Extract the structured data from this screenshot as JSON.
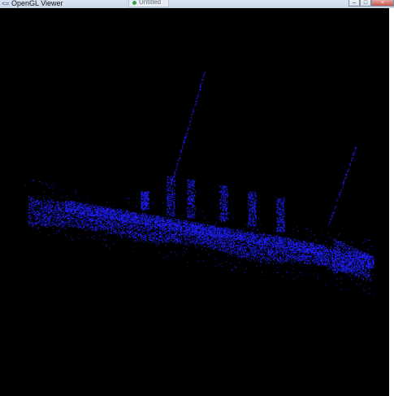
{
  "window": {
    "title": "OpenGL Viewer",
    "background_tab_label": "Untitled",
    "controls": {
      "minimize_icon": "minimize-icon",
      "maximize_icon": "maximize-icon",
      "close_icon": "close-icon"
    }
  },
  "viewport": {
    "background": "#000000",
    "point_color": "#1e1eff",
    "subject": "3D point cloud of a ship"
  }
}
